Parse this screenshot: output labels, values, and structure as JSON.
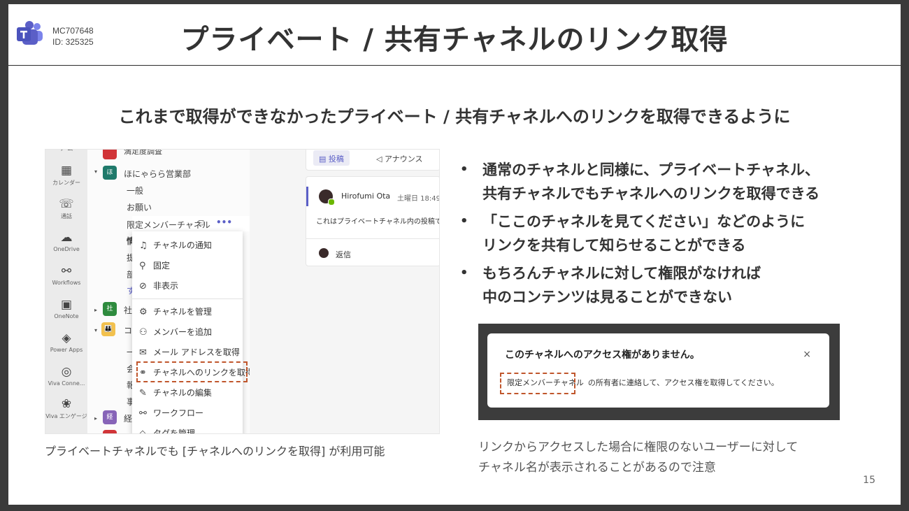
{
  "header": {
    "mc_id": "MC707648",
    "mc_sub": "ID: 325325",
    "title": "プライベート / 共有チャネルのリンク取得"
  },
  "subtitle": "これまで取得ができなかったプライベート / 共有チャネルへのリンクを取得できるように",
  "left_shot": {
    "rail": [
      {
        "icon": "calendar-icon",
        "glyph": "▦",
        "label": "カレンダー"
      },
      {
        "icon": "call-icon",
        "glyph": "☏",
        "label": "通話"
      },
      {
        "icon": "onedrive-icon",
        "glyph": "☁",
        "label": "OneDrive"
      },
      {
        "icon": "workflows-icon",
        "glyph": "⚯",
        "label": "Workflows"
      },
      {
        "icon": "onenote-icon",
        "glyph": "▣",
        "label": "OneNote"
      },
      {
        "icon": "power-apps-icon",
        "glyph": "◈",
        "label": "Power Apps"
      },
      {
        "icon": "viva-connections-icon",
        "glyph": "◎",
        "label": "Viva Conne..."
      },
      {
        "icon": "viva-engage-icon",
        "glyph": "❀",
        "label": "Viva エンゲージ"
      }
    ],
    "channels": {
      "top_cut": "満足度調査",
      "team1": "ほにゃらら営業部",
      "ch1": "一般",
      "ch2": "お願い",
      "ch3": "限定メンバーチャネル",
      "more": "•••",
      "frag1": "情",
      "frag2": "提",
      "frag3": "部",
      "frag4": "す",
      "team2": "社",
      "team3": "コラ",
      "frag5": "一",
      "frag6": "会",
      "frag7": "報",
      "frag8": "事",
      "team4": "経"
    },
    "menu": [
      {
        "icon": "bell-icon",
        "glyph": "🔔",
        "label": "チャネルの通知"
      },
      {
        "icon": "pin-icon",
        "glyph": "📌",
        "label": "固定"
      },
      {
        "icon": "hide-icon",
        "glyph": "⊘",
        "label": "非表示"
      },
      {
        "icon": "gear-icon",
        "glyph": "⚙",
        "label": "チャネルを管理"
      },
      {
        "icon": "add-member-icon",
        "glyph": "👤",
        "label": "メンバーを追加"
      },
      {
        "icon": "mail-icon",
        "glyph": "✉",
        "label": "メール アドレスを取得"
      },
      {
        "icon": "link-icon",
        "glyph": "🔗",
        "label": "チャネルへのリンクを取得"
      },
      {
        "icon": "edit-icon",
        "glyph": "✎",
        "label": "チャネルの編集"
      },
      {
        "icon": "workflow-icon",
        "glyph": "⚯",
        "label": "ワークフロー"
      },
      {
        "icon": "tag-icon",
        "glyph": "◇",
        "label": "タグを管理"
      }
    ],
    "feed": {
      "tab_post": "投稿",
      "tab_announce": "アナウンス",
      "author": "Hirofumi Ota",
      "time": "土曜日 18:49",
      "message": "これはプライベートチャネル内の投稿です",
      "reply": "返信"
    },
    "caption": "プライベートチャネルでも [チャネルへのリンクを取得] が利用可能"
  },
  "bullets": [
    [
      "通常のチャネルと同様に、プライベートチャネル、",
      "共有チャネルでもチャネルへのリンクを取得できる"
    ],
    [
      "「ここのチャネルを見てください」などのように",
      "リンクを共有して知らせることができる"
    ],
    [
      "もちろんチャネルに対して権限がなければ",
      "中のコンテンツは見ることができない"
    ]
  ],
  "dialog": {
    "title": "このチャネルへのアクセス権がありません。",
    "channel_name": "限定メンバーチャネル",
    "rest": "の所有者に連絡して、アクセス権を取得してください。",
    "close": "×"
  },
  "note": [
    "リンクからアクセスした場合に権限のないユーザーに対して",
    "チャネル名が表示されることがあるので注意"
  ],
  "page_number": "15",
  "colors": {
    "teams_purple": "#5b5fc7",
    "dashed_red": "#c0562c"
  }
}
